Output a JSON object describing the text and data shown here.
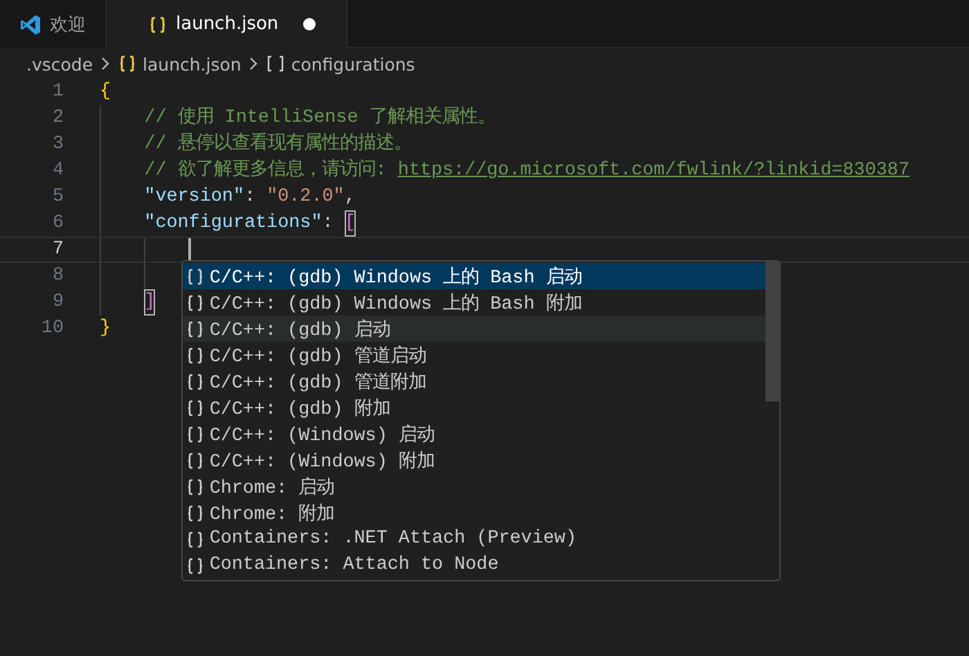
{
  "tabs": [
    {
      "label": "欢迎",
      "selected": false,
      "modified": false
    },
    {
      "label": "launch.json",
      "selected": true,
      "modified": true
    }
  ],
  "breadcrumb": [
    {
      "label": ".vscode",
      "kind": "folder"
    },
    {
      "label": "launch.json",
      "kind": "file"
    },
    {
      "label": "configurations",
      "kind": "array"
    }
  ],
  "editor": {
    "lines": [
      {
        "number": "1",
        "current": false,
        "tokens": [
          {
            "kind": "brace",
            "text": "{"
          }
        ],
        "children": [
          {
            "number": "2",
            "current": false,
            "tokens": [
              {
                "kind": "comment",
                "text": "// 使用 IntelliSense 了解相关属性。"
              }
            ]
          },
          {
            "number": "3",
            "current": false,
            "tokens": [
              {
                "kind": "comment",
                "text": "// 悬停以查看现有属性的描述。"
              }
            ]
          },
          {
            "number": "4",
            "current": false,
            "tokens": [
              {
                "kind": "comment",
                "text": "// 欲了解更多信息，请访问: "
              },
              {
                "kind": "link",
                "text": "https://go.microsoft.com/fwlink/?linkid=830387"
              }
            ]
          },
          {
            "number": "5",
            "current": false,
            "tokens": [
              {
                "kind": "key",
                "text": "\"version\""
              },
              {
                "kind": "punct",
                "text": ": "
              },
              {
                "kind": "string",
                "text": "\"0.2.0\""
              },
              {
                "kind": "punct",
                "text": ","
              }
            ]
          },
          {
            "number": "6",
            "current": false,
            "tokens": [
              {
                "kind": "key",
                "text": "\"configurations\""
              },
              {
                "kind": "punct",
                "text": ": "
              },
              {
                "kind": "bracket",
                "text": "[",
                "matched": true
              }
            ],
            "children": [
              {
                "number": "7",
                "current": true
              },
              {
                "number": "8",
                "current": false
              }
            ]
          },
          {
            "number": "9",
            "current": false,
            "tokens": [
              {
                "kind": "bracket",
                "text": "]",
                "matched": true
              }
            ]
          }
        ]
      },
      {
        "number": "10",
        "current": false,
        "tokens": [
          {
            "kind": "brace",
            "text": "}"
          }
        ]
      }
    ]
  },
  "suggest": {
    "items": [
      {
        "label": "C/C++: (gdb) Windows 上的 Bash 启动",
        "selected": true,
        "hovered": false
      },
      {
        "label": "C/C++: (gdb) Windows 上的 Bash 附加",
        "selected": false,
        "hovered": false
      },
      {
        "label": "C/C++: (gdb) 启动",
        "selected": false,
        "hovered": true
      },
      {
        "label": "C/C++: (gdb) 管道启动",
        "selected": false,
        "hovered": false
      },
      {
        "label": "C/C++: (gdb) 管道附加",
        "selected": false,
        "hovered": false
      },
      {
        "label": "C/C++: (gdb) 附加",
        "selected": false,
        "hovered": false
      },
      {
        "label": "C/C++: (Windows) 启动",
        "selected": false,
        "hovered": false
      },
      {
        "label": "C/C++: (Windows) 附加",
        "selected": false,
        "hovered": false
      },
      {
        "label": "Chrome: 启动",
        "selected": false,
        "hovered": false
      },
      {
        "label": "Chrome: 附加",
        "selected": false,
        "hovered": false
      },
      {
        "label": "Containers: .NET Attach (Preview)",
        "selected": false,
        "hovered": false
      },
      {
        "label": "Containers: Attach to Node",
        "selected": false,
        "hovered": false
      }
    ]
  }
}
